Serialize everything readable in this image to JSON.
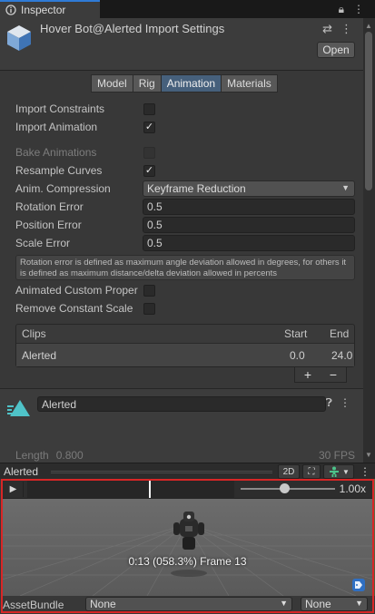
{
  "tab": {
    "label": "Inspector",
    "lock_icon": "lock-icon",
    "menu_icon": "kebab-menu-icon"
  },
  "header": {
    "title": "Hover Bot@Alerted Import Settings",
    "open_label": "Open"
  },
  "toolbar": {
    "tabs": [
      "Model",
      "Rig",
      "Animation",
      "Materials"
    ],
    "active": "Animation"
  },
  "settings": {
    "import_constraints": {
      "label": "Import Constraints",
      "checked": false
    },
    "import_animation": {
      "label": "Import Animation",
      "checked": true
    },
    "bake_animations": {
      "label": "Bake Animations",
      "checked": false,
      "disabled": true
    },
    "resample_curves": {
      "label": "Resample Curves",
      "checked": true
    },
    "anim_compression": {
      "label": "Anim. Compression",
      "value": "Keyframe Reduction"
    },
    "rotation_error": {
      "label": "Rotation Error",
      "value": "0.5"
    },
    "position_error": {
      "label": "Position Error",
      "value": "0.5"
    },
    "scale_error": {
      "label": "Scale Error",
      "value": "0.5"
    },
    "help_text": "Rotation error is defined as maximum angle deviation allowed in degrees, for others it is defined as maximum distance/delta deviation allowed in percents",
    "animated_custom_properties": {
      "label": "Animated Custom Proper",
      "checked": false
    },
    "remove_constant_scale": {
      "label": "Remove Constant Scale",
      "checked": false
    }
  },
  "clips": {
    "header": "Clips",
    "start_header": "Start",
    "end_header": "End",
    "rows": [
      {
        "name": "Alerted",
        "start": "0.0",
        "end": "24.0"
      }
    ],
    "add_label": "+",
    "remove_label": "−"
  },
  "clip_detail": {
    "name": "Alerted",
    "length_label": "Length",
    "length_value": "0.800",
    "fps": "30 FPS"
  },
  "preview": {
    "title": "Alerted",
    "mode_2d": "2D",
    "speed": "1.00x",
    "frame_label": "0:13 (058.3%) Frame 13",
    "timeline_progress": 0.583
  },
  "asset_bundle": {
    "label": "AssetBundle",
    "name": "None",
    "variant": "None"
  },
  "colors": {
    "accent": "#46607c",
    "highlight": "#d82626",
    "clip_icon": "#4fc3c8"
  }
}
